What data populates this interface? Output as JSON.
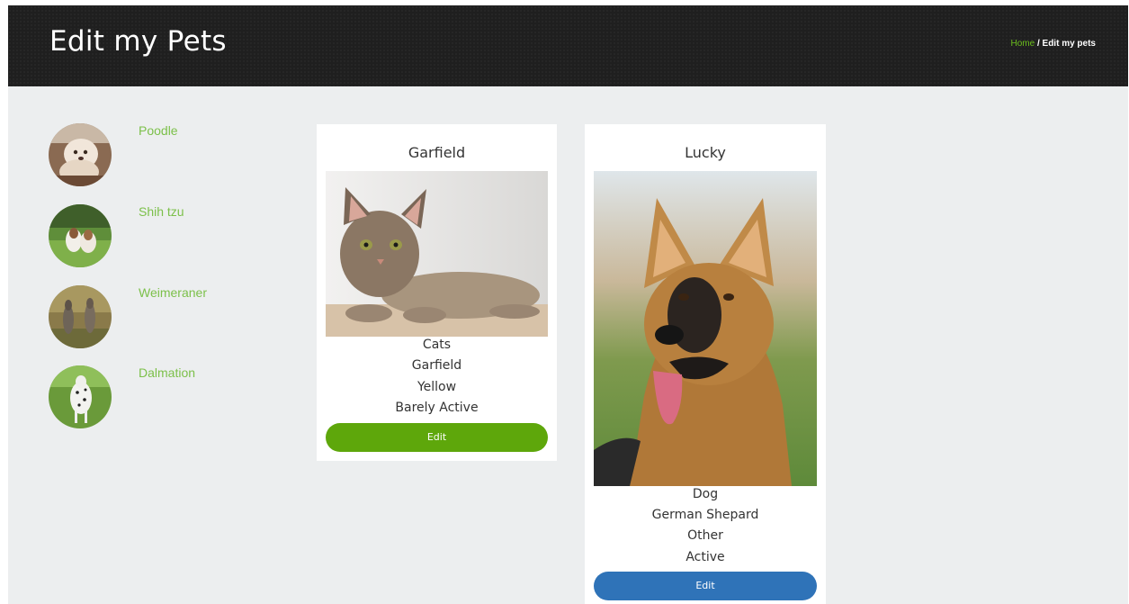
{
  "header": {
    "title": "Edit my Pets",
    "breadcrumb": {
      "home": "Home",
      "separator": " / ",
      "current": "Edit my pets"
    }
  },
  "sidebar": {
    "items": [
      {
        "label": "Poodle",
        "icon": "poodle-avatar"
      },
      {
        "label": "Shih tzu",
        "icon": "shih-tzu-avatar"
      },
      {
        "label": "Weimeraner",
        "icon": "weimeraner-avatar"
      },
      {
        "label": "Dalmation",
        "icon": "dalmation-avatar"
      }
    ]
  },
  "pets": [
    {
      "name": "Garfield",
      "photo": "cat-photo",
      "category": "Cats",
      "pet_name": "Garfield",
      "color": "Yellow",
      "activity": "Barely Active",
      "edit_label": "Edit",
      "button_color": "#5ea70b"
    },
    {
      "name": "Lucky",
      "photo": "german-shepherd-photo",
      "category": "Dog",
      "breed": "German Shepard",
      "color": "Other",
      "activity": "Active",
      "edit_label": "Edit",
      "button_color": "#2f73b8"
    }
  ],
  "colors": {
    "accent_green": "#7cc04a",
    "header_bg": "#1f1f1f",
    "page_bg": "#eceeef"
  }
}
